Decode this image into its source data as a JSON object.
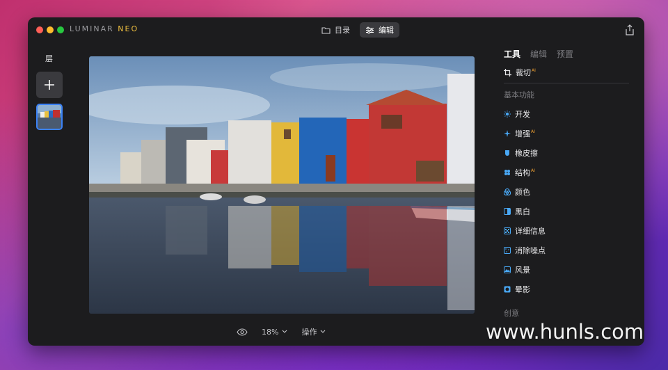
{
  "app": {
    "logo_main": "LUMINAR ",
    "logo_accent": "NEO",
    "nav": [
      {
        "label": "目录",
        "icon": "folder-icon"
      },
      {
        "label": "编辑",
        "icon": "sliders-icon",
        "active": true
      }
    ],
    "share_icon": "share-icon"
  },
  "left_panel": {
    "title": "层",
    "add_icon": "plus-icon"
  },
  "bottom_bar": {
    "eye_icon": "eye-icon",
    "zoom": "18%",
    "actions": "操作"
  },
  "right_panel": {
    "tabs": [
      {
        "label": "工具",
        "active": true
      },
      {
        "label": "编辑",
        "active": false
      },
      {
        "label": "预置",
        "active": false
      }
    ],
    "crop": {
      "label": "裁切",
      "ai": "AI"
    },
    "section_basic": "基本功能",
    "tools": [
      {
        "label": "开发",
        "ai": "",
        "icon": "sun-icon",
        "color": "#49a8f5"
      },
      {
        "label": "增强",
        "ai": "AI",
        "icon": "sparkle-icon",
        "color": "#49a8f5"
      },
      {
        "label": "橡皮擦",
        "ai": "",
        "icon": "eraser-icon",
        "color": "#49a8f5"
      },
      {
        "label": "结构",
        "ai": "AI",
        "icon": "structure-icon",
        "color": "#49a8f5"
      },
      {
        "label": "颜色",
        "ai": "",
        "icon": "color-icon",
        "color": "#49a8f5"
      },
      {
        "label": "黑白",
        "ai": "",
        "icon": "bw-icon",
        "color": "#49a8f5"
      },
      {
        "label": "详细信息",
        "ai": "",
        "icon": "details-icon",
        "color": "#49a8f5"
      },
      {
        "label": "消除噪点",
        "ai": "",
        "icon": "denoise-icon",
        "color": "#49a8f5"
      },
      {
        "label": "风景",
        "ai": "",
        "icon": "landscape-icon",
        "color": "#49a8f5"
      },
      {
        "label": "晕影",
        "ai": "",
        "icon": "vignette-icon",
        "color": "#49a8f5"
      }
    ],
    "section_creative": "创意"
  },
  "watermark": "www.hunls.com"
}
